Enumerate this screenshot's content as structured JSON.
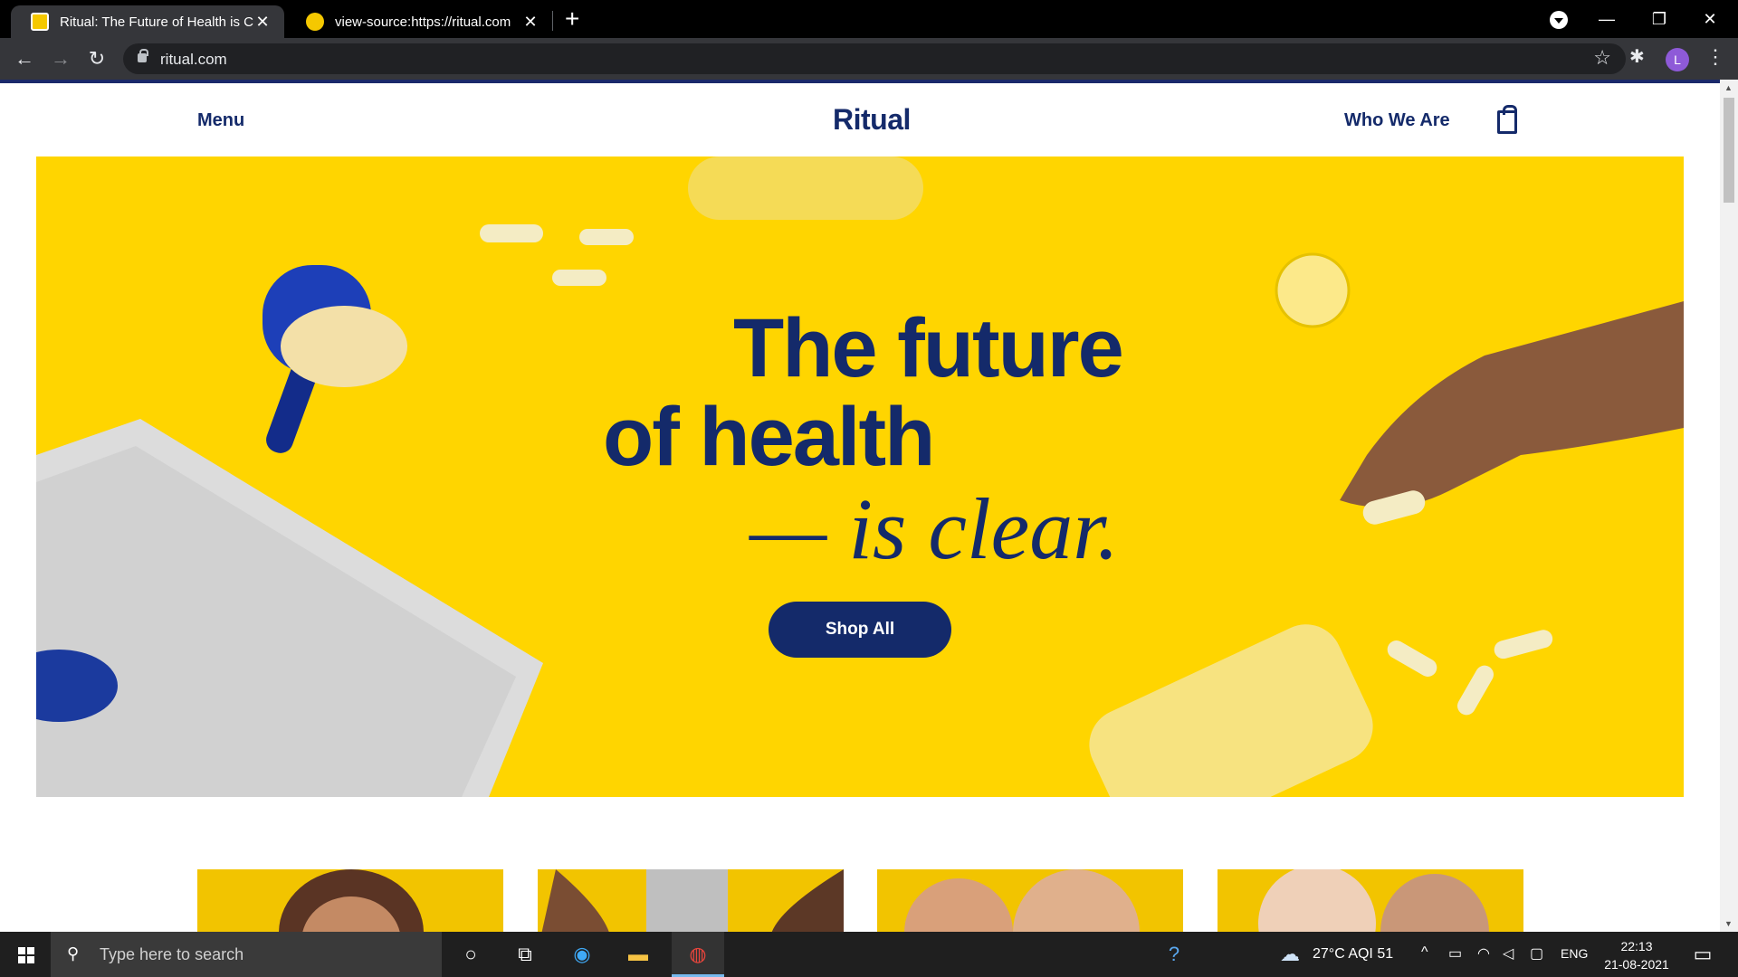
{
  "browser": {
    "tabs": [
      {
        "title": "Ritual: The Future of Health is Cle",
        "close": "✕"
      },
      {
        "title": "view-source:https://ritual.com",
        "close": "✕"
      }
    ],
    "new_tab": "+",
    "url": "ritual.com",
    "profile_initial": "L"
  },
  "site": {
    "menu_label": "Menu",
    "logo": "Ritual",
    "who_label": "Who We Are",
    "hero": {
      "line1": "The future",
      "line2": "of health",
      "line3": "— is clear.",
      "cta": "Shop All"
    },
    "colors": {
      "brand_navy": "#142a6a",
      "hero_yellow": "#ffd500"
    }
  },
  "taskbar": {
    "search_placeholder": "Type here to search",
    "weather": "27°C  AQI 51",
    "language": "ENG",
    "time": "22:13",
    "date": "21-08-2021"
  }
}
